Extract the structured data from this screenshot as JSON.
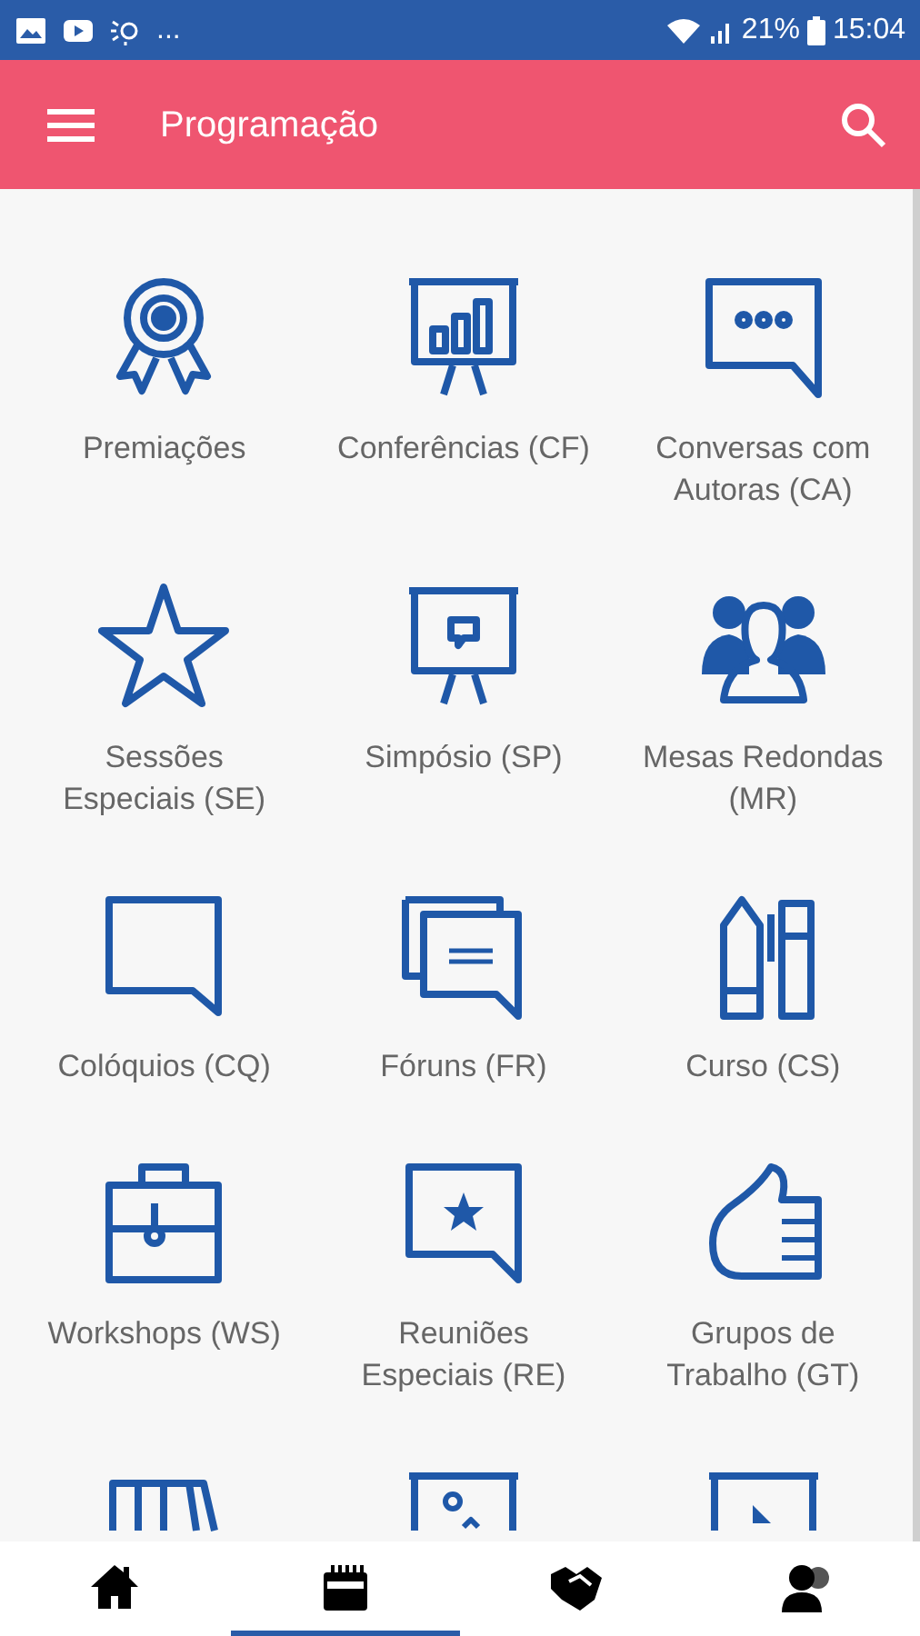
{
  "status_bar": {
    "notification_more": "...",
    "battery": "21%",
    "time": "15:04"
  },
  "app_bar": {
    "title": "Programação"
  },
  "grid": [
    {
      "kind": "award",
      "label_lines": [
        "Premiações"
      ]
    },
    {
      "kind": "chart-board",
      "label_lines": [
        "Conferências (CF)"
      ]
    },
    {
      "kind": "chat-dots",
      "label_lines": [
        "Conversas com",
        "Autoras (CA)"
      ]
    },
    {
      "kind": "star",
      "label_lines": [
        "Sessões",
        "Especiais (SE)"
      ]
    },
    {
      "kind": "chat-board",
      "label_lines": [
        "Simpósio (SP)"
      ]
    },
    {
      "kind": "people",
      "label_lines": [
        "Mesas Redondas",
        "(MR)"
      ]
    },
    {
      "kind": "chat",
      "label_lines": [
        "Colóquios (CQ)"
      ]
    },
    {
      "kind": "chats",
      "label_lines": [
        "Fóruns (FR)"
      ]
    },
    {
      "kind": "pencils",
      "label_lines": [
        "Curso (CS)"
      ]
    },
    {
      "kind": "briefcase",
      "label_lines": [
        "Workshops (WS)"
      ]
    },
    {
      "kind": "chat-star",
      "label_lines": [
        "Reuniões",
        "Especiais (RE)"
      ]
    },
    {
      "kind": "thumb",
      "label_lines": [
        "Grupos de",
        "Trabalho (GT)"
      ]
    },
    {
      "kind": "stand"
    },
    {
      "kind": "image-board"
    },
    {
      "kind": "play-board"
    }
  ],
  "bottom_nav": [
    {
      "kind": "home",
      "selected": false
    },
    {
      "kind": "calendar",
      "selected": true
    },
    {
      "kind": "handshake",
      "selected": false
    },
    {
      "kind": "people",
      "selected": false
    }
  ]
}
